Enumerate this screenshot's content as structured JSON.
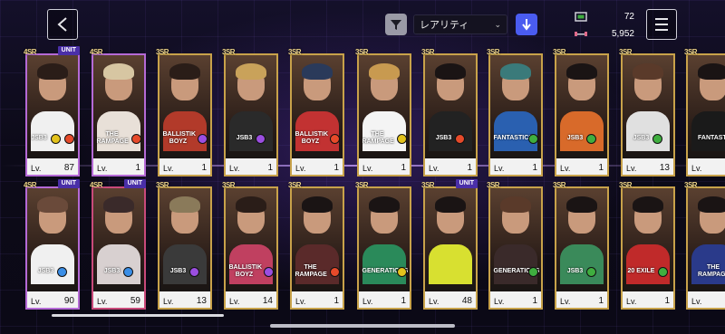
{
  "header": {
    "back_icon": "chevron-left-icon",
    "filter_icon": "filter-funnel-icon",
    "sort_value": "レアリティ",
    "order_icon": "arrow-down-icon",
    "stats": [
      {
        "icon": "ticket-icon",
        "value": "72"
      },
      {
        "icon": "dumbbell-icon",
        "value": "5,952"
      }
    ],
    "menu_icon": "hamburger-menu-icon"
  },
  "cards": [
    {
      "rank": "4SR",
      "unit": "UNIT",
      "frame": "purple",
      "logo": "JSB3",
      "attr": "#e3c21c",
      "attr2": "#e64a2a",
      "lv_label": "Lv.",
      "level": "87",
      "body": "#f0f0f0",
      "hair": "#2a1d18"
    },
    {
      "rank": "4SR",
      "unit": "",
      "frame": "purple",
      "logo": "THE RAMPAGE",
      "attr": "#e64a2a",
      "attr2": "",
      "lv_label": "Lv.",
      "level": "1",
      "body": "#e8e0d8",
      "hair": "#d7c6a2"
    },
    {
      "rank": "3SR",
      "unit": "",
      "frame": "gold",
      "logo": "BALLISTIK BOYZ",
      "attr": "#9b4ee0",
      "attr2": "",
      "lv_label": "Lv.",
      "level": "1",
      "body": "#b23a2a",
      "hair": "#2a1d18"
    },
    {
      "rank": "3SR",
      "unit": "",
      "frame": "gold",
      "logo": "JSB3",
      "attr": "#9b4ee0",
      "attr2": "",
      "lv_label": "Lv.",
      "level": "1",
      "body": "#2a2a2a",
      "hair": "#c9a25a"
    },
    {
      "rank": "3SR",
      "unit": "",
      "frame": "gold",
      "logo": "BALLISTIK BOYZ",
      "attr": "#e64a2a",
      "attr2": "",
      "lv_label": "Lv.",
      "level": "1",
      "body": "#c23232",
      "hair": "#2a3a5a"
    },
    {
      "rank": "3SR",
      "unit": "",
      "frame": "gold",
      "logo": "THE RAMPAGE",
      "attr": "#e3c21c",
      "attr2": "",
      "lv_label": "Lv.",
      "level": "1",
      "body": "#f4f4f4",
      "hair": "#c89a50"
    },
    {
      "rank": "3SR",
      "unit": "",
      "frame": "gold",
      "logo": "JSB3",
      "attr": "#e64a2a",
      "attr2": "",
      "lv_label": "Lv.",
      "level": "1",
      "body": "#222",
      "hair": "#1a1414"
    },
    {
      "rank": "3SR",
      "unit": "",
      "frame": "gold",
      "logo": "FANTASTICS",
      "attr": "#3fae3f",
      "attr2": "",
      "lv_label": "Lv.",
      "level": "1",
      "body": "#2a60b0",
      "hair": "#3a7a7a"
    },
    {
      "rank": "3SR",
      "unit": "",
      "frame": "gold",
      "logo": "JSB3",
      "attr": "#3fae3f",
      "attr2": "",
      "lv_label": "Lv.",
      "level": "1",
      "body": "#d86a2a",
      "hair": "#1a1414"
    },
    {
      "rank": "3SR",
      "unit": "",
      "frame": "gold",
      "logo": "JSB3",
      "attr": "#3fae3f",
      "attr2": "",
      "lv_label": "Lv.",
      "level": "13",
      "body": "#e0e0e0",
      "hair": "#5a3a2a"
    },
    {
      "rank": "3SR",
      "unit": "",
      "frame": "gold",
      "logo": "FANTASTICS",
      "attr": "",
      "attr2": "",
      "lv_label": "Lv.",
      "level": "",
      "body": "#1a1a1a",
      "hair": "#1a1414"
    },
    {
      "rank": "4SR",
      "unit": "UNIT",
      "frame": "purple",
      "logo": "JSB3",
      "attr": "#3a8ee6",
      "attr2": "",
      "lv_label": "Lv.",
      "level": "90",
      "body": "#f0f0f0",
      "hair": "#6a4a3a"
    },
    {
      "rank": "4SR",
      "unit": "UNIT",
      "frame": "red",
      "logo": "JSB3",
      "attr": "#3a8ee6",
      "attr2": "",
      "lv_label": "Lv.",
      "level": "59",
      "body": "#d8d0d0",
      "hair": "#3a2a2a"
    },
    {
      "rank": "3SR",
      "unit": "",
      "frame": "gold",
      "logo": "JSB3",
      "attr": "#9b4ee0",
      "attr2": "",
      "lv_label": "Lv.",
      "level": "13",
      "body": "#3a3a3a",
      "hair": "#8a7a5a"
    },
    {
      "rank": "3SR",
      "unit": "",
      "frame": "gold",
      "logo": "BALLISTIK BOYZ",
      "attr": "#9b4ee0",
      "attr2": "",
      "lv_label": "Lv.",
      "level": "14",
      "body": "#c04060",
      "hair": "#2a1d18"
    },
    {
      "rank": "3SR",
      "unit": "",
      "frame": "gold",
      "logo": "THE RAMPAGE",
      "attr": "#e64a2a",
      "attr2": "",
      "lv_label": "Lv.",
      "level": "1",
      "body": "#5a2a2a",
      "hair": "#1a1414"
    },
    {
      "rank": "3SR",
      "unit": "",
      "frame": "gold",
      "logo": "GENERATIONS",
      "attr": "#e3c21c",
      "attr2": "",
      "lv_label": "Lv.",
      "level": "1",
      "body": "#2a8a5a",
      "hair": "#1a1414"
    },
    {
      "rank": "3SR",
      "unit": "UNIT",
      "frame": "gold",
      "logo": "",
      "attr": "",
      "attr2": "",
      "lv_label": "Lv.",
      "level": "48",
      "body": "#d8e030",
      "hair": "#1a1414"
    },
    {
      "rank": "3SR",
      "unit": "",
      "frame": "gold",
      "logo": "GENERATIONS",
      "attr": "#3fae3f",
      "attr2": "",
      "lv_label": "Lv.",
      "level": "1",
      "body": "#3a2a2a",
      "hair": "#5a3a2a"
    },
    {
      "rank": "3SR",
      "unit": "",
      "frame": "gold",
      "logo": "JSB3",
      "attr": "#3fae3f",
      "attr2": "",
      "lv_label": "Lv.",
      "level": "1",
      "body": "#3a8a5a",
      "hair": "#1a1414"
    },
    {
      "rank": "3SR",
      "unit": "",
      "frame": "gold",
      "logo": "20 EXILE",
      "attr": "#3fae3f",
      "attr2": "",
      "lv_label": "Lv.",
      "level": "1",
      "body": "#c02a2a",
      "hair": "#1a1414"
    },
    {
      "rank": "3SR",
      "unit": "",
      "frame": "gold",
      "logo": "THE RAMPAGE",
      "attr": "",
      "attr2": "",
      "lv_label": "Lv.",
      "level": "",
      "body": "#2a3a8a",
      "hair": "#1a1414"
    }
  ]
}
